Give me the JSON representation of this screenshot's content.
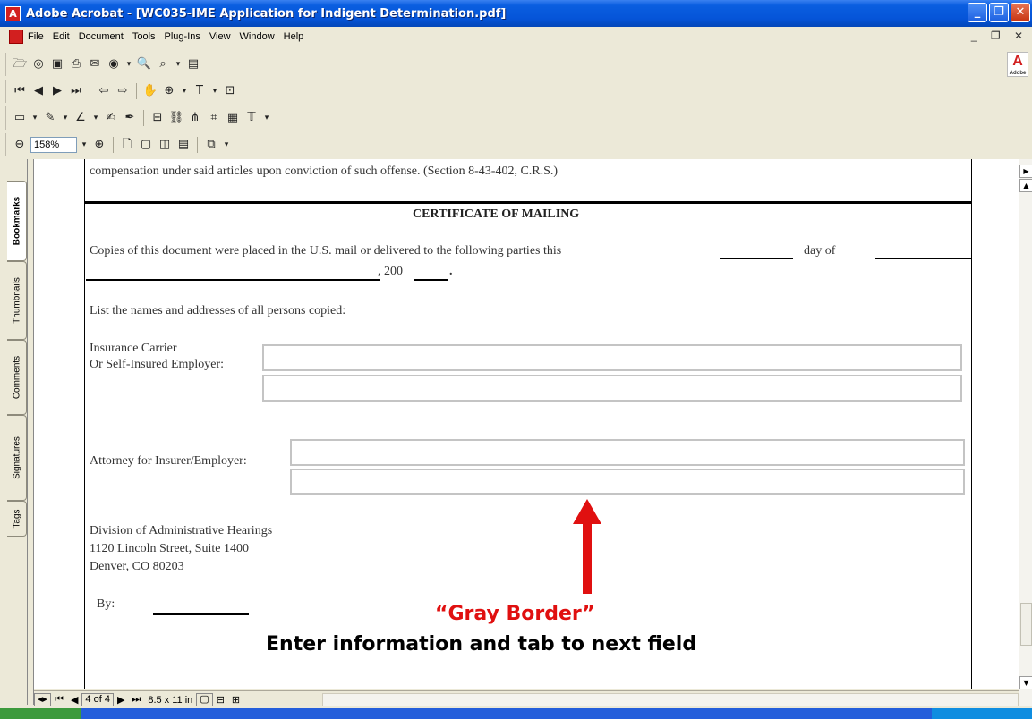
{
  "window": {
    "title": "Adobe Acrobat - [WC035-IME Application for Indigent Determination.pdf]",
    "app_icon": "adobe-acrobat-icon",
    "controls": [
      "minimize-icon",
      "restore-icon",
      "close-icon"
    ]
  },
  "menu": {
    "items": [
      "File",
      "Edit",
      "Document",
      "Tools",
      "Plug-Ins",
      "View",
      "Window",
      "Help"
    ]
  },
  "toolbar": {
    "zoom_value": "158%"
  },
  "nav_tabs": [
    "Bookmarks",
    "Thumbnails",
    "Comments",
    "Signatures",
    "Tags"
  ],
  "document": {
    "line_top": "compensation under said articles upon conviction of such offense. (Section 8-43-402, C.R.S.)",
    "heading": "CERTIFICATE OF MAILING",
    "copies_text": "Copies of this document were placed in the U.S. mail or delivered to the following parties this",
    "day_of": "day of",
    "year_prefix": ", 200",
    "year_suffix": ".",
    "list_text": "List the names and addresses of all persons copied:",
    "insurance_label_1": "Insurance Carrier",
    "insurance_label_2": "Or Self-Insured Employer:",
    "attorney_label": "Attorney for Insurer/Employer:",
    "division_line_1": "Division of Administrative Hearings",
    "division_line_2": "1120 Lincoln Street, Suite 1400",
    "division_line_3": "Denver, CO 80203",
    "by_label": "By:"
  },
  "annotations": {
    "gray_border": "“Gray Border”",
    "instruction": "Enter information and tab to next field",
    "arrow_color": "#e01010"
  },
  "status": {
    "page": "4 of 4",
    "page_size": "8.5 x 11 in"
  }
}
